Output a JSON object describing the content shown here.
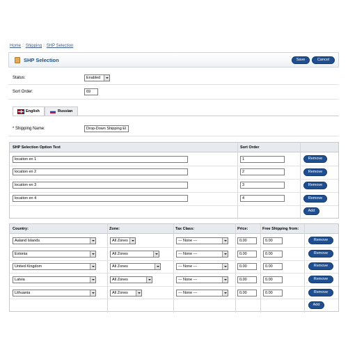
{
  "breadcrumb": {
    "items": [
      "Home",
      "Shipping",
      "SHP Selection"
    ],
    "separator": "::"
  },
  "heading": {
    "title": "SHP Selection",
    "save_label": "Save",
    "cancel_label": "Cancel"
  },
  "form": {
    "status_label": "Status:",
    "status_value": "Enabled",
    "sort_order_label": "Sort Order:",
    "sort_order_value": "69"
  },
  "tabs": [
    {
      "label": "English",
      "icon": "uk-flag-icon"
    },
    {
      "label": "Russian",
      "icon": "russia-flag-icon"
    }
  ],
  "shipping_name": {
    "label": "* Shipping Name:",
    "value": "Drop-Down Shipping El"
  },
  "options_table": {
    "headers": {
      "text": "SHP Selection Option Text",
      "sort": "Sort Order"
    },
    "rows": [
      {
        "text": "location en 1",
        "sort": "1"
      },
      {
        "text": "location en 2",
        "sort": "2"
      },
      {
        "text": "location en 3",
        "sort": "3"
      },
      {
        "text": "location en 4",
        "sort": "4"
      }
    ],
    "remove_label": "Remove",
    "add_label": "Add"
  },
  "country_table": {
    "headers": {
      "country": "Country:",
      "zone": "Zone:",
      "tax": "Tax Class:",
      "price": "Price:",
      "free": "Free Shipping from:"
    },
    "rows": [
      {
        "country": "Aaland Islands",
        "zone": "All Zones",
        "tax": "--- None ---",
        "price": "0.00",
        "free": "0.00"
      },
      {
        "country": "Estonia",
        "zone": "All Zones",
        "tax": "--- None ---",
        "price": "0.00",
        "free": "0.00"
      },
      {
        "country": "United Kingdom",
        "zone": "All Zones",
        "tax": "--- None ---",
        "price": "0.00",
        "free": "0.00"
      },
      {
        "country": "Latvia",
        "zone": "All Zones",
        "tax": "--- None ---",
        "price": "0.00",
        "free": "0.00"
      },
      {
        "country": "Lithuania",
        "zone": "All Zones",
        "tax": "--- None ---",
        "price": "0.00",
        "free": "0.00"
      }
    ],
    "remove_label": "Remove",
    "add_label": "Add"
  },
  "colors": {
    "button": "#1f4f91",
    "heading_text": "#1c4f8a",
    "link": "#3d5a8a",
    "header_bg": "#e7eaee"
  }
}
